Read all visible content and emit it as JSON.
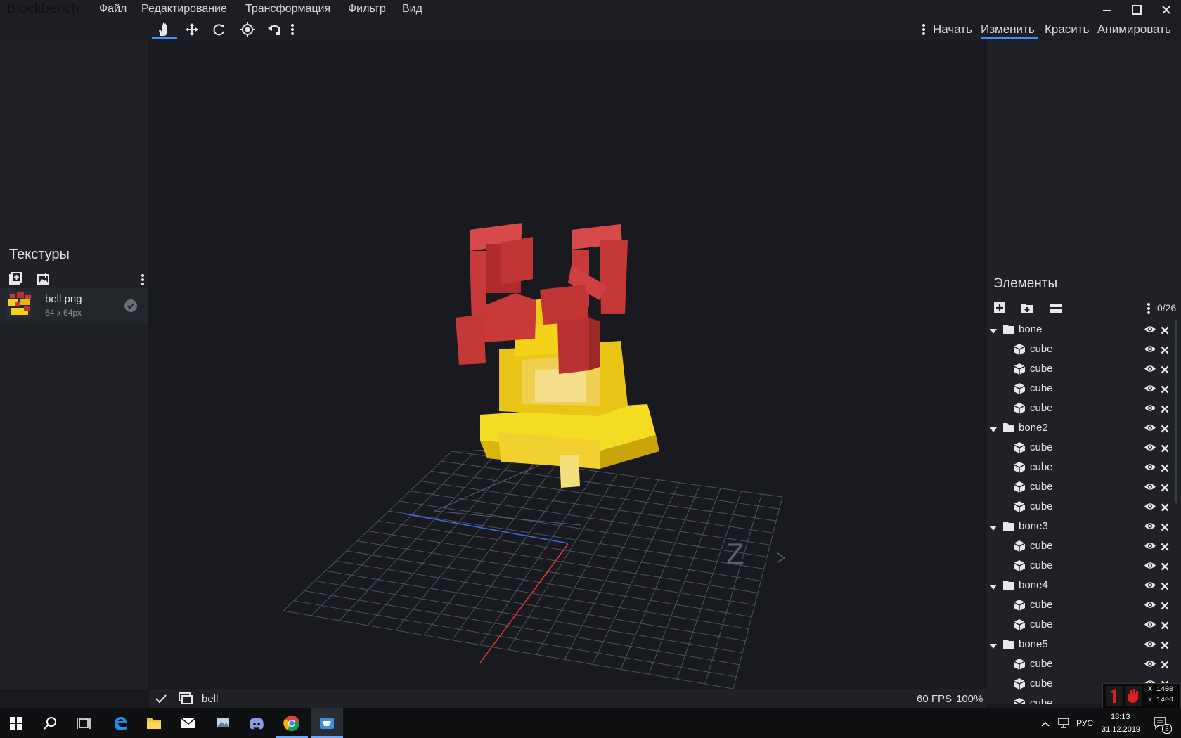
{
  "app": {
    "name": "Blockbench"
  },
  "menu": [
    "Файл",
    "Редактирование",
    "Трансформация",
    "Фильтр",
    "Вид"
  ],
  "window_controls": {
    "minimize": "minimize-icon",
    "maximize": "maximize-icon",
    "close": "close-icon"
  },
  "toolbar": {
    "tools": [
      "hand-icon",
      "move-icon",
      "rotate-icon",
      "pivot-icon",
      "undo-icon"
    ],
    "modes": [
      "Начать",
      "Изменить",
      "Красить",
      "Анимировать"
    ],
    "active_mode": "Изменить"
  },
  "textures": {
    "title": "Текстуры",
    "items": [
      {
        "name": "bell.png",
        "size": "64 x 64px"
      }
    ]
  },
  "outliner": {
    "title": "Элементы",
    "count": "0/26",
    "rows": [
      {
        "type": "group",
        "label": "bone"
      },
      {
        "type": "cube",
        "label": "cube"
      },
      {
        "type": "cube",
        "label": "cube"
      },
      {
        "type": "cube",
        "label": "cube"
      },
      {
        "type": "cube",
        "label": "cube"
      },
      {
        "type": "group",
        "label": "bone2"
      },
      {
        "type": "cube",
        "label": "cube"
      },
      {
        "type": "cube",
        "label": "cube"
      },
      {
        "type": "cube",
        "label": "cube"
      },
      {
        "type": "cube",
        "label": "cube"
      },
      {
        "type": "group",
        "label": "bone3"
      },
      {
        "type": "cube",
        "label": "cube"
      },
      {
        "type": "cube",
        "label": "cube"
      },
      {
        "type": "group",
        "label": "bone4"
      },
      {
        "type": "cube",
        "label": "cube"
      },
      {
        "type": "cube",
        "label": "cube"
      },
      {
        "type": "group",
        "label": "bone5"
      },
      {
        "type": "cube",
        "label": "cube"
      },
      {
        "type": "cube",
        "label": "cube"
      },
      {
        "type": "cube",
        "label": "cube"
      }
    ]
  },
  "status": {
    "model_name": "bell",
    "fps": "60 FPS",
    "zoom": "100%"
  },
  "overlay": {
    "x": "X 1400",
    "y": "Y 1400"
  },
  "taskbar": {
    "apps": [
      "windows-start-icon",
      "search-icon",
      "task-view-icon",
      "edge-icon",
      "explorer-icon",
      "mail-icon",
      "photos-icon",
      "discord-icon",
      "chrome-icon",
      "blockbench-icon"
    ],
    "lang": "РУС",
    "time": "18:13",
    "date": "31.12.2019",
    "notifications": "5"
  },
  "colors": {
    "accent": "#3e90ff",
    "bell_yellow": "#f4d21a",
    "ribbon_red": "#c83a3a"
  }
}
